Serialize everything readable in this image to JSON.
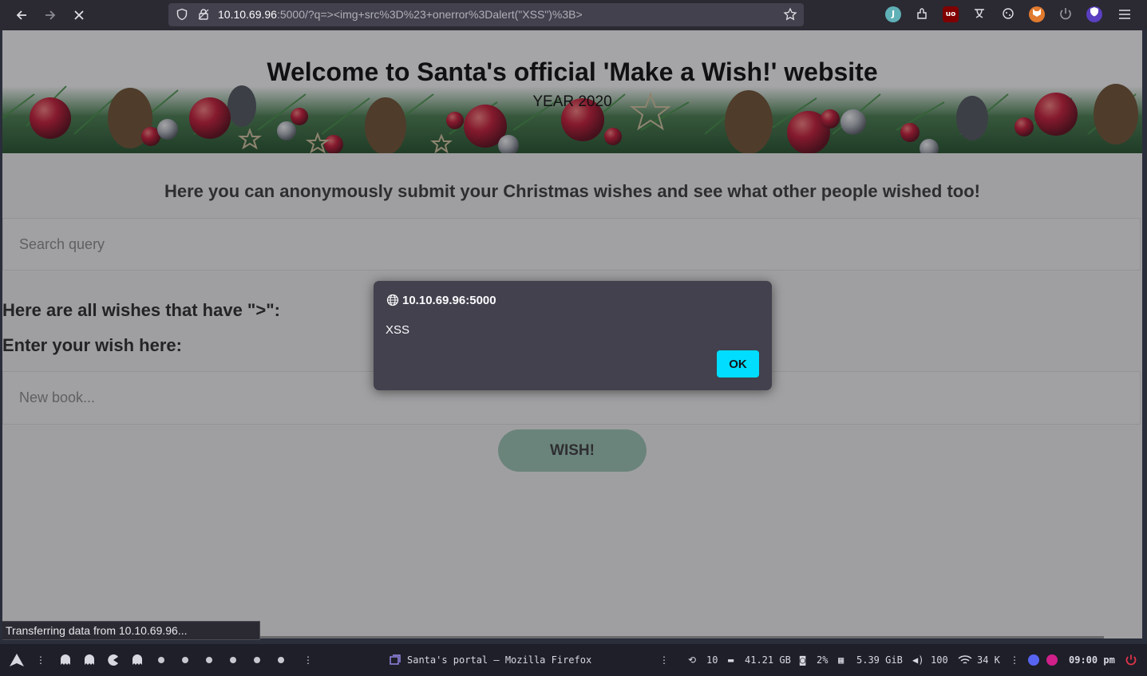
{
  "browser": {
    "url_host": "10.10.69.96",
    "url_rest": ":5000/?q=><img+src%3D%23+onerror%3Dalert(\"XSS\")%3B>",
    "status_text": "Transferring data from 10.10.69.96..."
  },
  "page": {
    "banner_title": "Welcome to Santa's official 'Make a Wish!' website",
    "banner_year": "YEAR 2020",
    "intro": "Here you can anonymously submit your Christmas wishes and see what other people wished too!",
    "search_placeholder": "Search query",
    "results_label": "Here are all wishes that have \">\":",
    "wish_label": "Enter your wish here:",
    "wish_placeholder": "New book...",
    "wish_button": "WISH!"
  },
  "dialog": {
    "origin": "10.10.69.96:5000",
    "message": "XSS",
    "ok_label": "OK"
  },
  "taskbar": {
    "window_title": "Santa's portal — Mozilla Firefox",
    "updates": "10",
    "disk": "41.21 GB",
    "cpu": "2%",
    "memory": "5.39 GiB",
    "volume": "100",
    "network": "34 K",
    "clock": "09:00 pm"
  },
  "colors": {
    "accent_ok": "#00ddff",
    "wish_button": "#9cc7b4",
    "toolbar": "#2b2a33"
  }
}
